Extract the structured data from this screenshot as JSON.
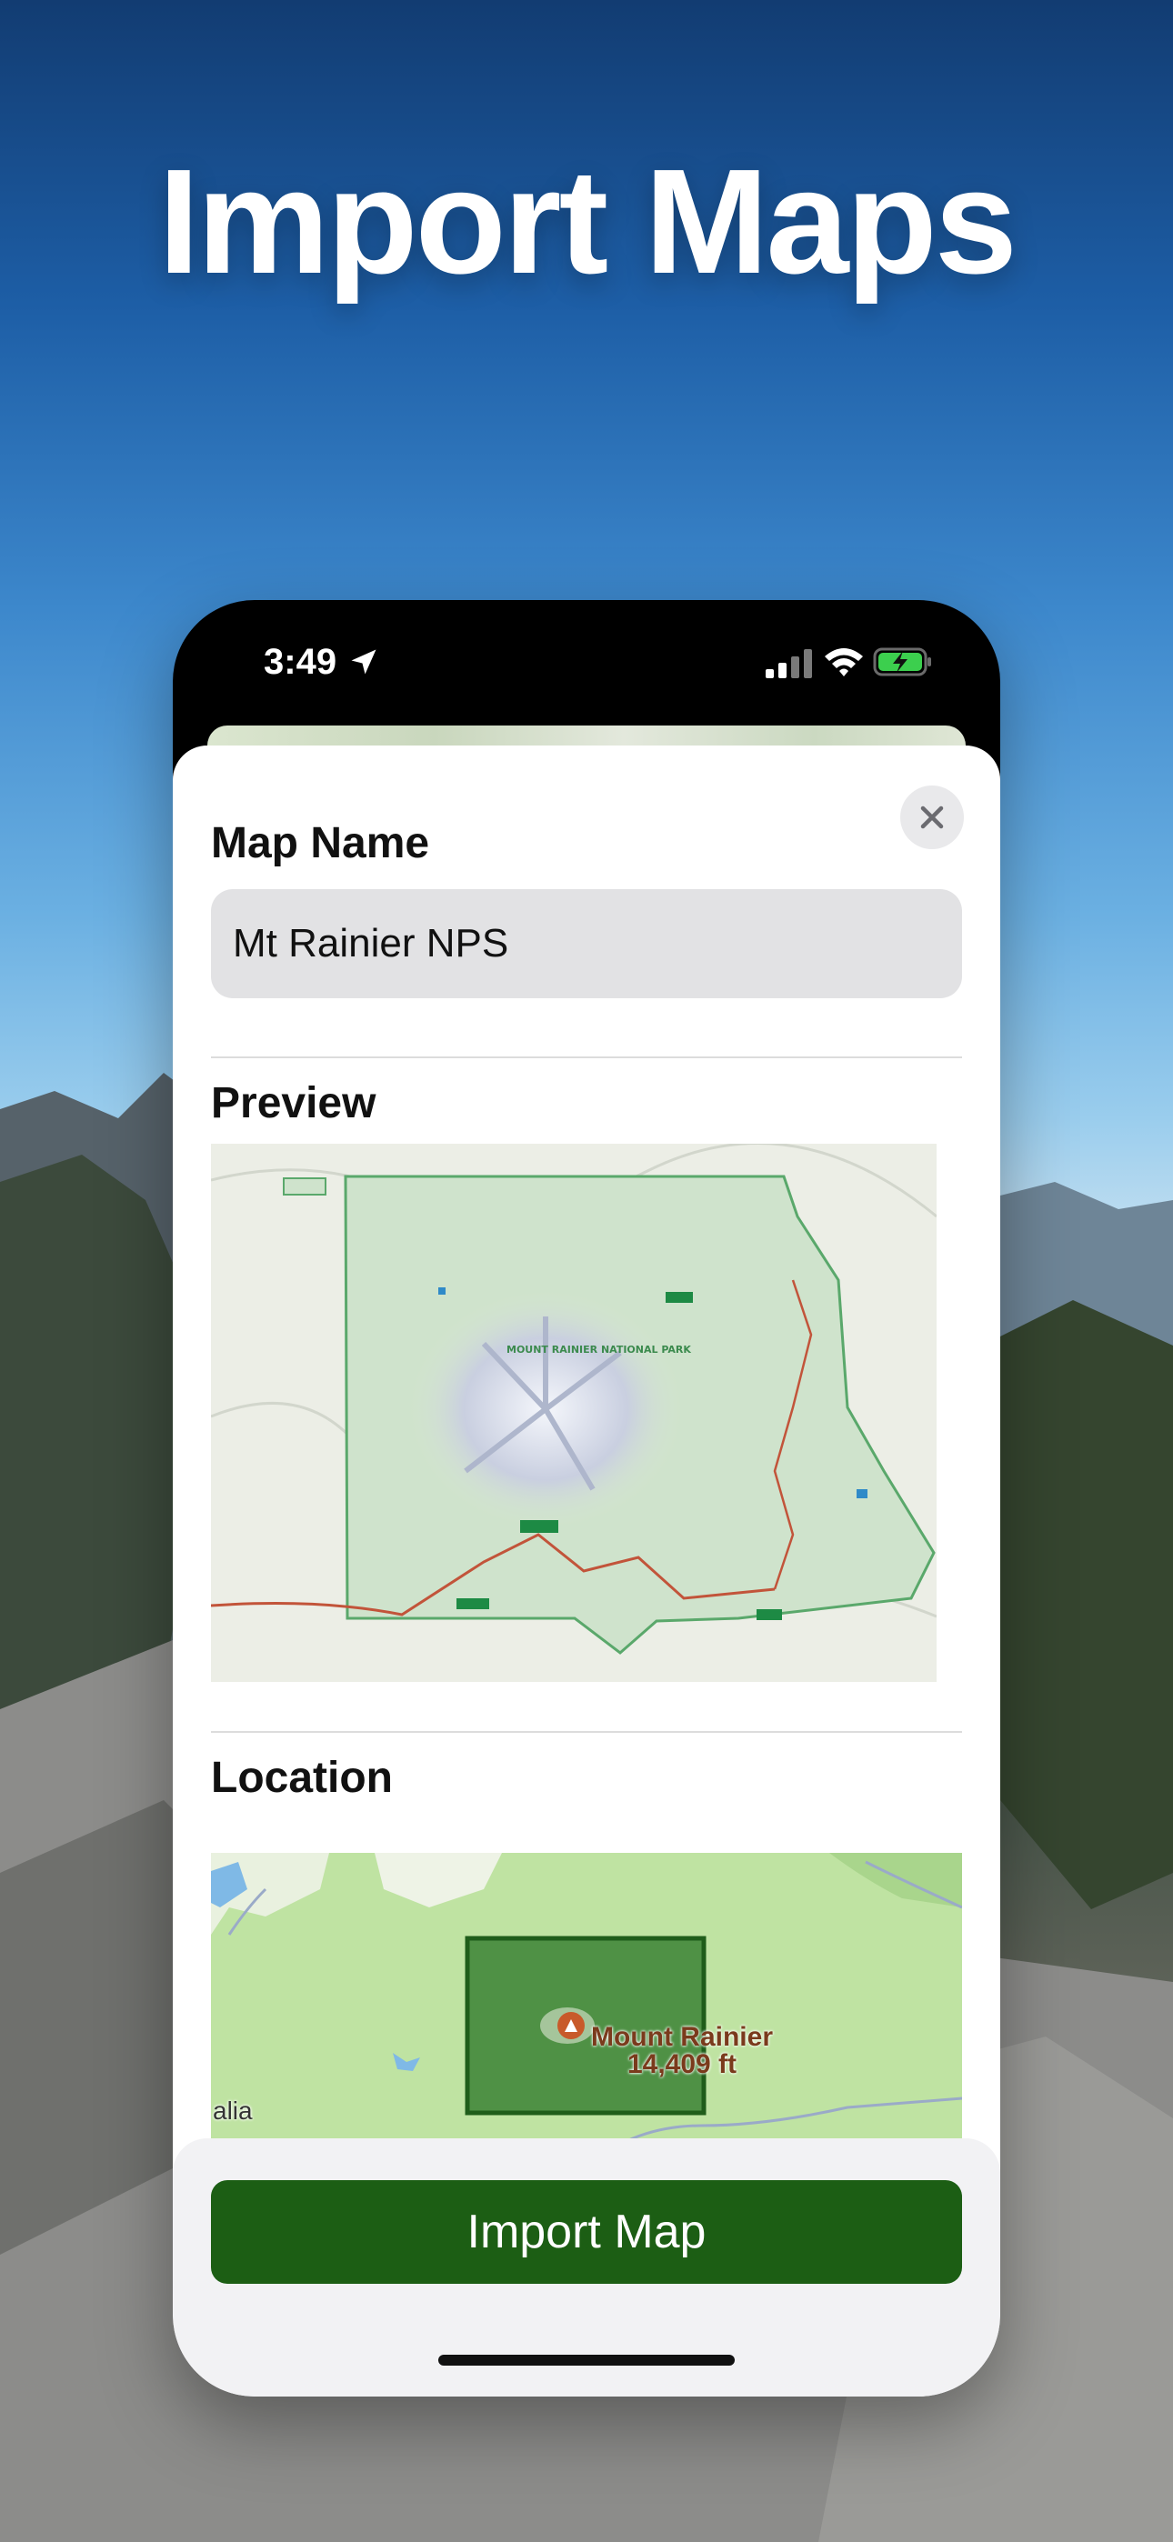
{
  "headline": "Import Maps",
  "status_bar": {
    "time": "3:49",
    "icons": [
      "location-arrow-icon",
      "cellular-signal-icon",
      "wifi-icon",
      "battery-charging-icon"
    ]
  },
  "sheet": {
    "map_name_label": "Map Name",
    "map_name_value": "Mt Rainier NPS",
    "preview_label": "Preview",
    "preview_map_title": "MOUNT RAINIER NATIONAL PARK",
    "location_label": "Location",
    "location_map": {
      "poi_name": "Mount Rainier",
      "poi_elevation": "14,409 ft",
      "edge_label": "alia"
    },
    "import_button_label": "Import Map"
  },
  "colors": {
    "accent_button": "#1c5e14",
    "park_boundary": "#5aa86b",
    "location_region": "#2f7a2a"
  }
}
